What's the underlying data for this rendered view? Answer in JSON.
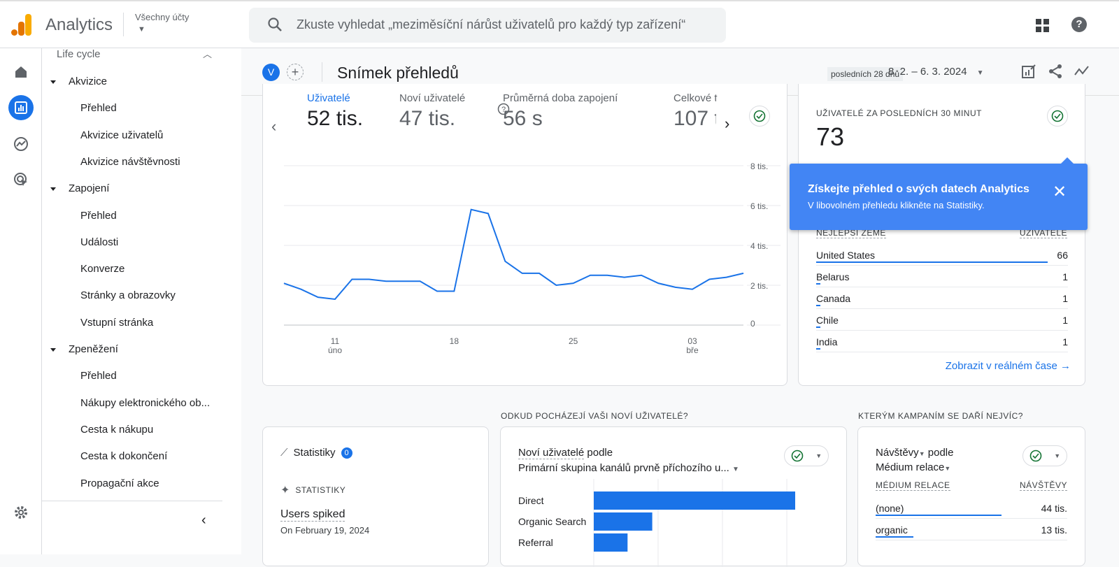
{
  "app": {
    "name": "Analytics",
    "account_label": "Všechny účty",
    "search_placeholder": "Zkuste vyhledat „meziměsíční nárůst uživatelů pro každý typ zařízení“"
  },
  "nav": {
    "header": "Life cycle",
    "items": [
      {
        "label": "Akvizice",
        "type": "section"
      },
      {
        "label": "Přehled",
        "type": "sub"
      },
      {
        "label": "Akvizice uživatelů",
        "type": "sub"
      },
      {
        "label": "Akvizice návštěvnosti",
        "type": "sub"
      },
      {
        "label": "Zapojení",
        "type": "section"
      },
      {
        "label": "Přehled",
        "type": "sub"
      },
      {
        "label": "Události",
        "type": "sub"
      },
      {
        "label": "Konverze",
        "type": "sub"
      },
      {
        "label": "Stránky a obrazovky",
        "type": "sub"
      },
      {
        "label": "Vstupní stránka",
        "type": "sub"
      },
      {
        "label": "Zpeněžení",
        "type": "section"
      },
      {
        "label": "Přehled",
        "type": "sub"
      },
      {
        "label": "Nákupy elektronického ob...",
        "type": "sub"
      },
      {
        "label": "Cesta k nákupu",
        "type": "sub"
      },
      {
        "label": "Cesta k dokončení",
        "type": "sub"
      },
      {
        "label": "Propagační akce",
        "type": "sub"
      }
    ]
  },
  "header": {
    "avatar": "V",
    "title": "Snímek přehledů",
    "range_label": "posledních 28 dnů",
    "dates": "8. 2. – 6. 3. 2024"
  },
  "metrics": [
    {
      "label": "Uživatelé",
      "value": "52 tis."
    },
    {
      "label": "Noví uživatelé",
      "value": "47 tis."
    },
    {
      "label": "Průměrná doba zapojení",
      "value": "56 s"
    },
    {
      "label": "Celkové t",
      "value": "107 t"
    }
  ],
  "chart_data": [
    {
      "type": "line",
      "x_ticks": [
        {
          "day": "11",
          "month": "úno"
        },
        {
          "day": "18",
          "month": ""
        },
        {
          "day": "25",
          "month": ""
        },
        {
          "day": "03",
          "month": "bře"
        }
      ],
      "y_ticks": [
        "0",
        "2 tis.",
        "4 tis.",
        "6 tis.",
        "8 tis."
      ],
      "ylim": [
        0,
        8000
      ],
      "grid": true,
      "x": [
        "2024-02-08",
        "2024-02-09",
        "2024-02-10",
        "2024-02-11",
        "2024-02-12",
        "2024-02-13",
        "2024-02-14",
        "2024-02-15",
        "2024-02-16",
        "2024-02-17",
        "2024-02-18",
        "2024-02-19",
        "2024-02-20",
        "2024-02-21",
        "2024-02-22",
        "2024-02-23",
        "2024-02-24",
        "2024-02-25",
        "2024-02-26",
        "2024-02-27",
        "2024-02-28",
        "2024-02-29",
        "2024-03-01",
        "2024-03-02",
        "2024-03-03",
        "2024-03-04",
        "2024-03-05",
        "2024-03-06"
      ],
      "values": [
        2100,
        1800,
        1400,
        1300,
        2300,
        2300,
        2200,
        2200,
        2200,
        1700,
        1700,
        5800,
        5600,
        3200,
        2600,
        2600,
        2000,
        2100,
        2500,
        2500,
        2400,
        2500,
        2100,
        1900,
        1800,
        2300,
        2400,
        2600
      ],
      "color": "#1a73e8"
    },
    {
      "type": "bar",
      "orientation": "horizontal",
      "categories": [
        "Direct",
        "Organic Search",
        "Referral"
      ],
      "values": [
        31000,
        9000,
        5200
      ],
      "color": "#1a73e8"
    }
  ],
  "realtime": {
    "title": "UŽIVATELÉ ZA POSLEDNÍCH 30 MINUT",
    "value": "73",
    "col1": "NEJLEPŠÍ ZEMĚ",
    "col2": "UŽIVATELÉ",
    "rows": [
      {
        "country": "United States",
        "users": "66",
        "share": 0.92
      },
      {
        "country": "Belarus",
        "users": "1",
        "share": 0.015
      },
      {
        "country": "Canada",
        "users": "1",
        "share": 0.015
      },
      {
        "country": "Chile",
        "users": "1",
        "share": 0.015
      },
      {
        "country": "India",
        "users": "1",
        "share": 0.015
      }
    ],
    "link": "Zobrazit v reálném čase"
  },
  "tooltip": {
    "title": "Získejte přehled o svých datech Analytics",
    "text": "V libovolném přehledu klikněte na Statistiky."
  },
  "insights": {
    "title": "Statistiky",
    "count": "0",
    "caps": "STATISTIKY",
    "headline": "Users spiked",
    "date": "On February 19, 2024"
  },
  "sources": {
    "section": "ODKUD POCHÁZEJÍ VAŠI NOVÍ UŽIVATELÉ?",
    "metric": "Noví uživatelé",
    "by": "podle",
    "dimension": "Primární skupina kanálů prvně příchozího u..."
  },
  "campaigns": {
    "section": "KTERÝM KAMPANÍM SE DAŘÍ NEJVÍC?",
    "metric": "Návštěvy",
    "by": "podle",
    "dimension": "Médium relace",
    "col1": "MÉDIUM RELACE",
    "col2": "NÁVŠTĚVY",
    "rows": [
      {
        "name": "(none)",
        "value": "44 tis.",
        "share": 0.77
      },
      {
        "name": "organic",
        "value": "13 tis.",
        "share": 0.23
      }
    ]
  }
}
